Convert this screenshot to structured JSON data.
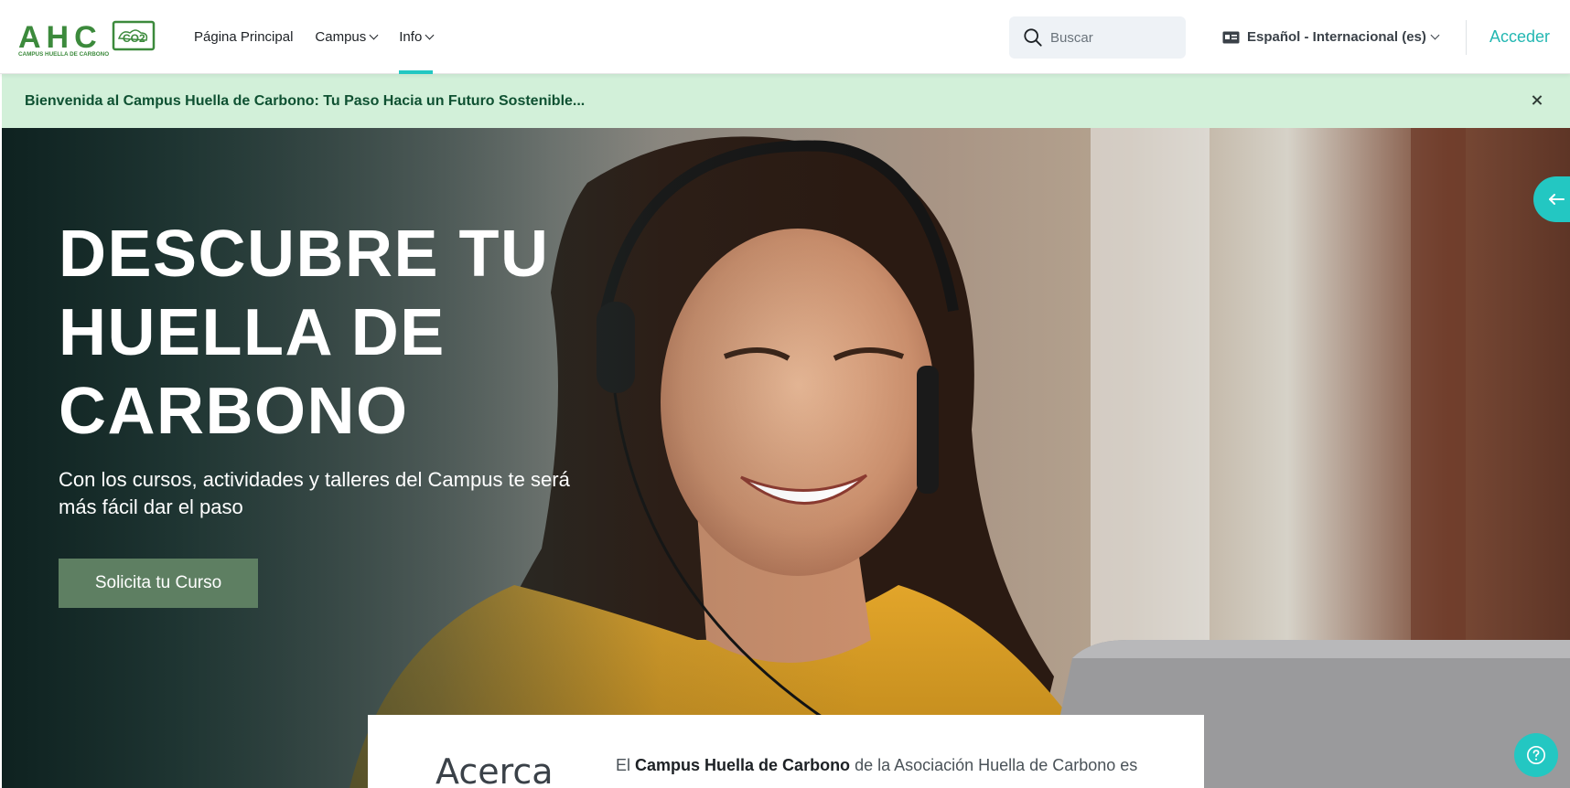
{
  "navbar": {
    "logo": {
      "letters": "A H C",
      "badge": "CO2",
      "tagline": "CAMPUS HUELLA DE CARBONO"
    },
    "links": [
      {
        "label": "Página Principal",
        "has_dropdown": false,
        "active": false
      },
      {
        "label": "Campus",
        "has_dropdown": true,
        "active": false
      },
      {
        "label": "Info",
        "has_dropdown": true,
        "active": true
      }
    ],
    "search_placeholder": "Buscar",
    "language": "Español - Internacional (es)",
    "login_label": "Acceder"
  },
  "alert": {
    "message": "Bienvenida al Campus Huella de Carbono: Tu Paso Hacia un Futuro Sostenible..."
  },
  "hero": {
    "title": "DESCUBRE TU HUELLA DE CARBONO",
    "subtitle": "Con los cursos, actividades y talleres del Campus te será más fácil dar el paso",
    "cta_label": "Solicita tu Curso"
  },
  "about": {
    "heading": "Acerca",
    "text_prefix": "El ",
    "text_bold": "Campus Huella de Carbono",
    "text_rest": " de la Asociación Huella de Carbono es"
  },
  "colors": {
    "accent_teal": "#23c7c2",
    "alert_bg": "#d2f0d9",
    "alert_text": "#0f5132",
    "cta_green": "#5e7f62",
    "logo_green": "#3c8a3c"
  },
  "icons": {
    "search": "search-icon",
    "language": "language-icon",
    "close": "close-icon",
    "drawer": "arrow-left-icon",
    "help": "question-mark-icon"
  }
}
